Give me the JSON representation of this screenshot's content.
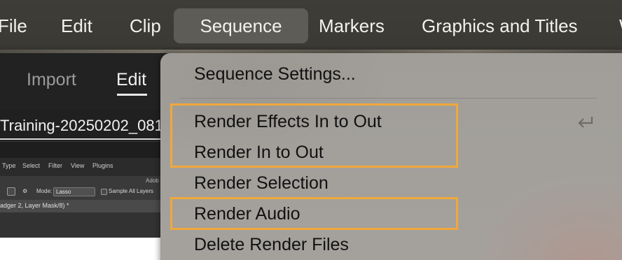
{
  "menubar": {
    "items": [
      {
        "label": "File"
      },
      {
        "label": "Edit"
      },
      {
        "label": "Clip"
      },
      {
        "label": "Sequence"
      },
      {
        "label": "Markers"
      },
      {
        "label": "Graphics and Titles"
      },
      {
        "label": "W"
      }
    ],
    "active": "Sequence"
  },
  "app": {
    "tabs": [
      {
        "label": "Import"
      },
      {
        "label": "Edit",
        "active": true
      }
    ],
    "filename": "Training-20250202_081"
  },
  "thumbnail": {
    "menu": [
      "Type",
      "Select",
      "Filter",
      "View",
      "Plugins"
    ],
    "brand_fragment": "Adob",
    "mode_label": "Mode:",
    "mode_value": "Lasso",
    "sample_label": "Sample All Layers",
    "doc_tab": "adger 2, Layer Mask/8) *"
  },
  "sequence_menu": {
    "items": [
      {
        "label": "Sequence Settings..."
      },
      {
        "label": "Render Effects In to Out",
        "shortcut_icon": "return-key-icon"
      },
      {
        "label": "Render In to Out"
      },
      {
        "label": "Render Selection"
      },
      {
        "label": "Render Audio"
      },
      {
        "label": "Delete Render Files"
      }
    ],
    "highlight_color": "#f0a83a"
  }
}
